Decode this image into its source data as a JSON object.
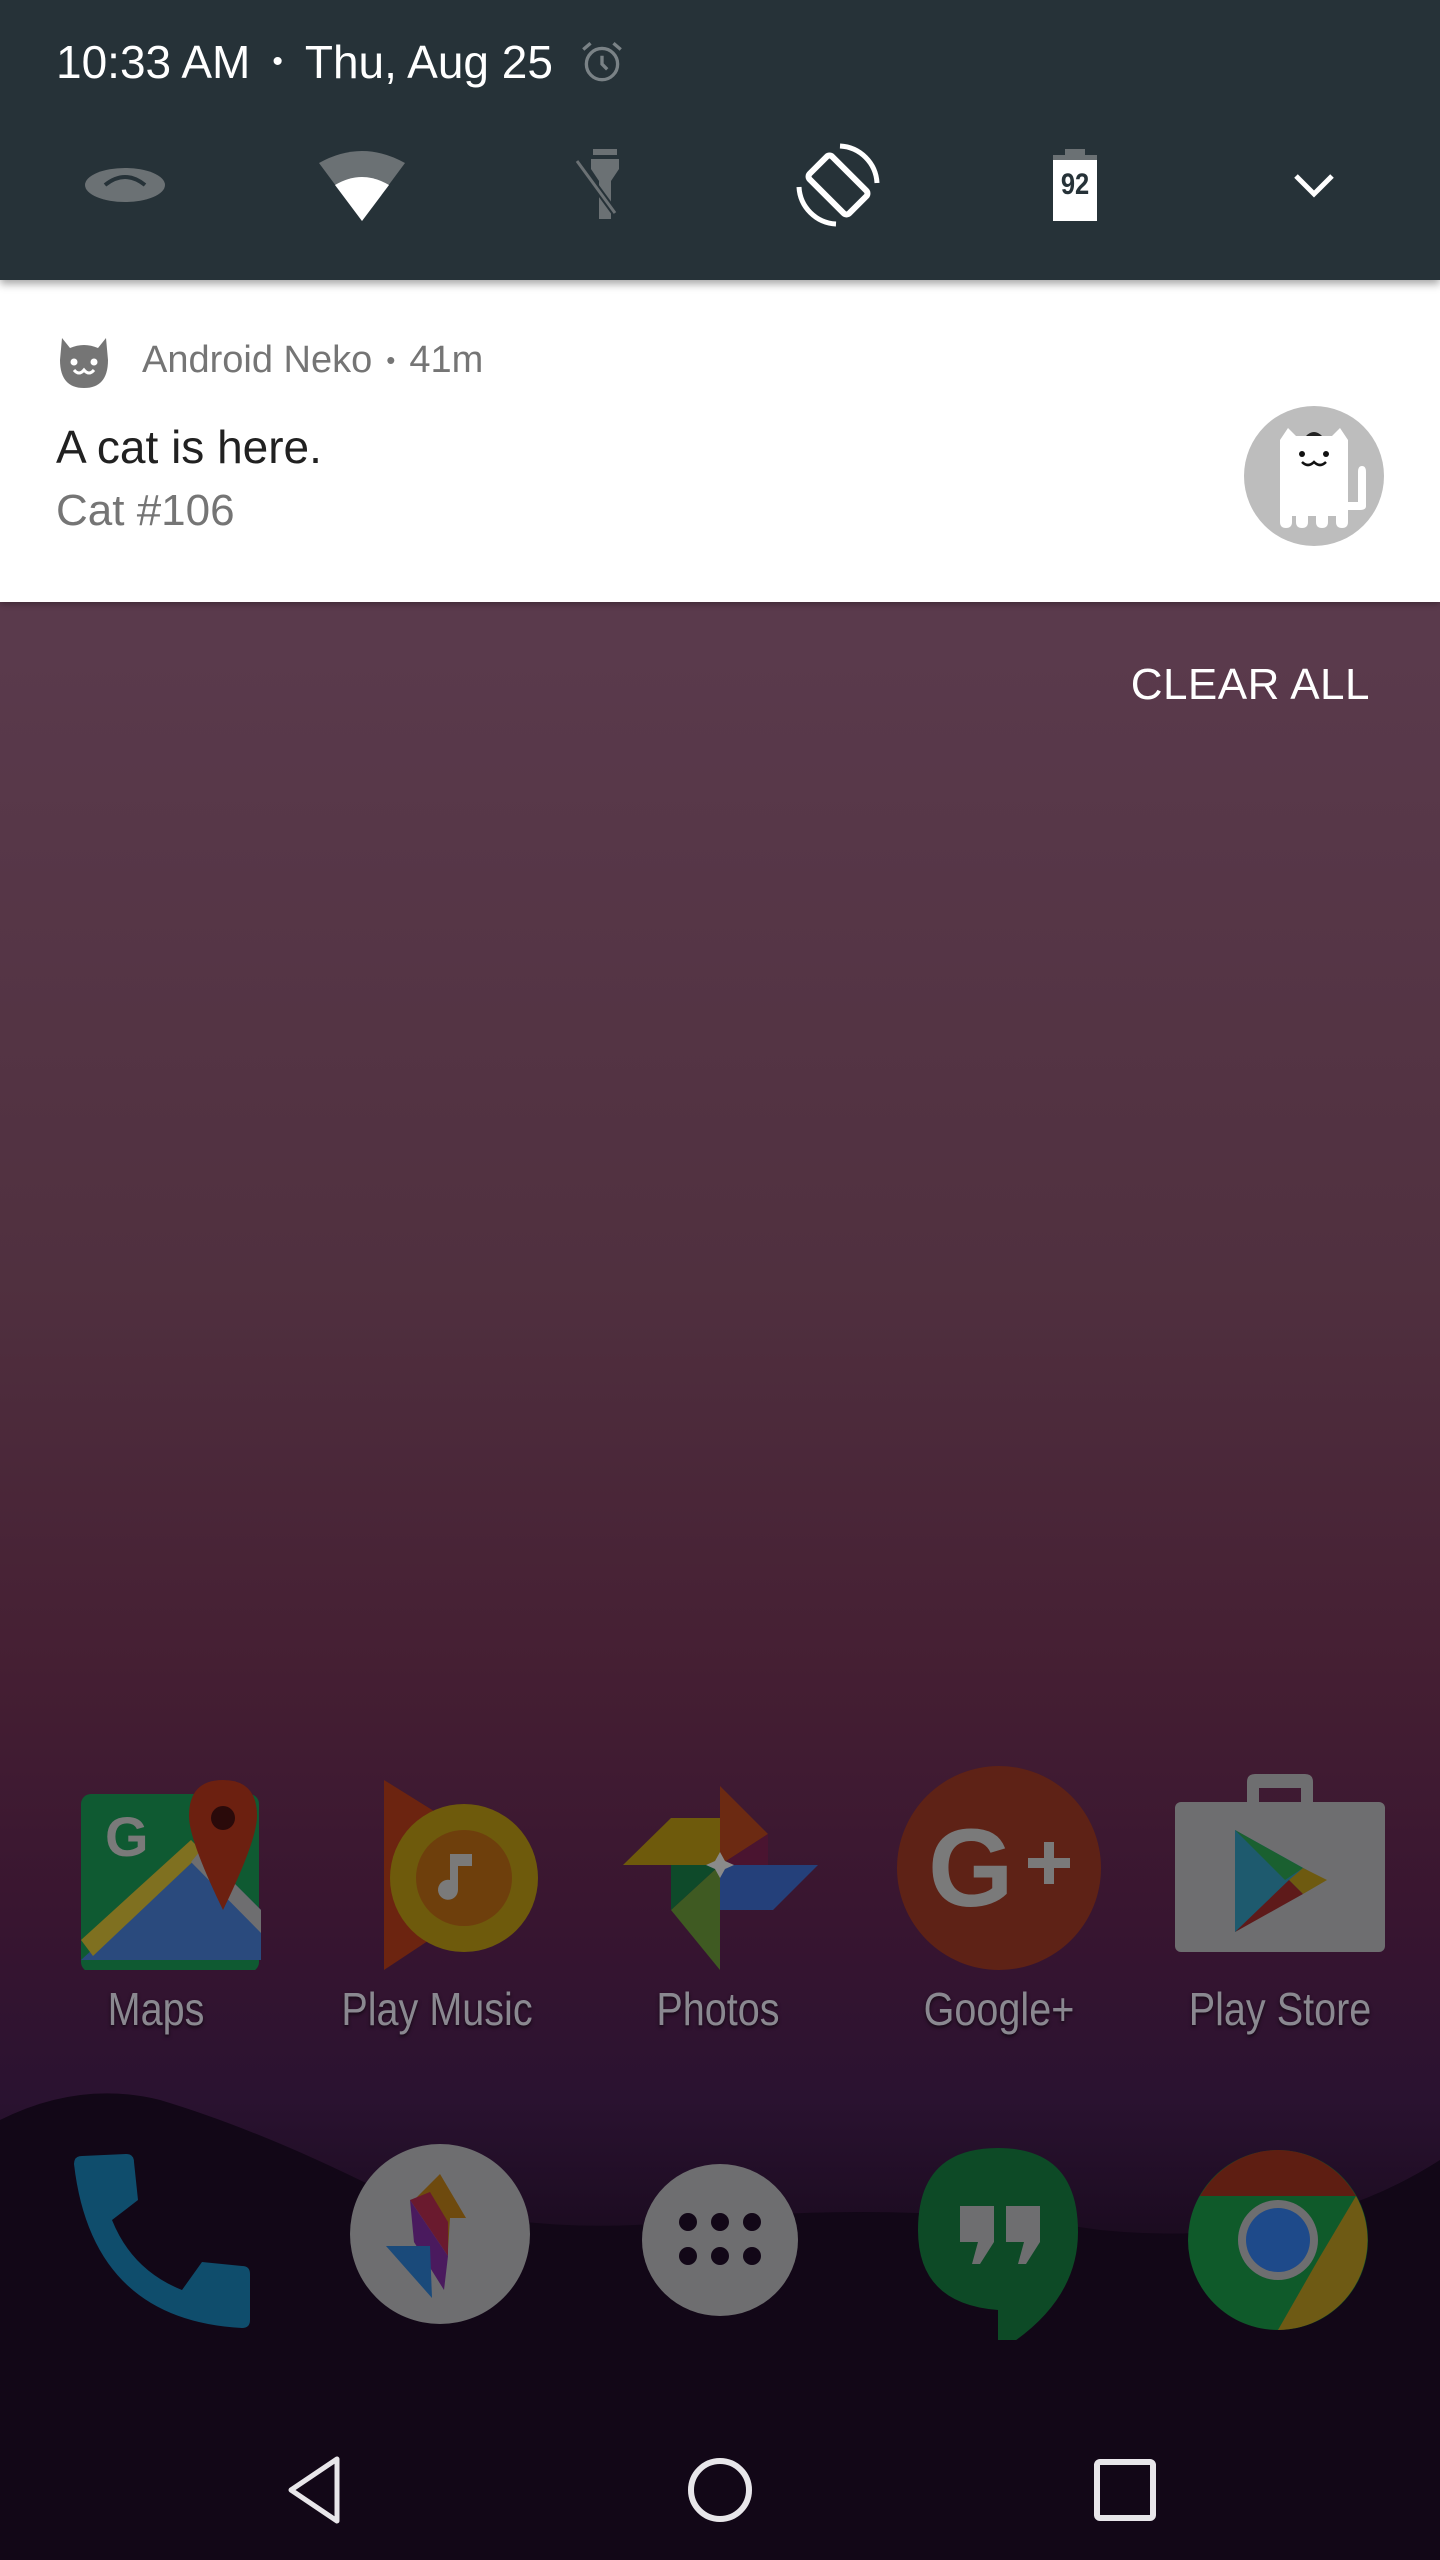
{
  "status_header": {
    "time": "10:33 AM",
    "separator": "•",
    "date": "Thu, Aug 25",
    "alarm_icon": "alarm-clock-icon"
  },
  "quick_settings": {
    "tiles": [
      {
        "name": "data-saver",
        "icon": "data-saver-icon",
        "state": "off"
      },
      {
        "name": "wifi",
        "icon": "wifi-icon",
        "state": "on"
      },
      {
        "name": "flashlight",
        "icon": "flashlight-off-icon",
        "state": "off"
      },
      {
        "name": "auto-rotate",
        "icon": "auto-rotate-icon",
        "state": "on"
      },
      {
        "name": "battery",
        "icon": "battery-icon",
        "value": "92"
      },
      {
        "name": "expand",
        "icon": "chevron-down-icon"
      }
    ],
    "battery_level": "92"
  },
  "notification": {
    "app_name": "Android Neko",
    "separator": "•",
    "time_ago": "41m",
    "title": "A cat is here.",
    "text": "Cat #106",
    "app_icon": "cat-face-icon",
    "large_icon": "neko-cat-icon"
  },
  "clear_all_label": "CLEAR ALL",
  "home_apps": [
    {
      "label": "Maps",
      "icon": "maps-icon"
    },
    {
      "label": "Play Music",
      "icon": "play-music-icon"
    },
    {
      "label": "Photos",
      "icon": "photos-icon"
    },
    {
      "label": "Google+",
      "icon": "google-plus-icon"
    },
    {
      "label": "Play Store",
      "icon": "play-store-icon"
    }
  ],
  "dock": [
    {
      "name": "Phone",
      "icon": "phone-icon"
    },
    {
      "name": "Allo",
      "icon": "allo-icon"
    },
    {
      "name": "App drawer",
      "icon": "app-drawer-icon"
    },
    {
      "name": "Hangouts",
      "icon": "hangouts-icon"
    },
    {
      "name": "Chrome",
      "icon": "chrome-icon"
    }
  ],
  "navigation": {
    "back": "back-icon",
    "home": "home-icon",
    "recents": "recents-icon"
  }
}
